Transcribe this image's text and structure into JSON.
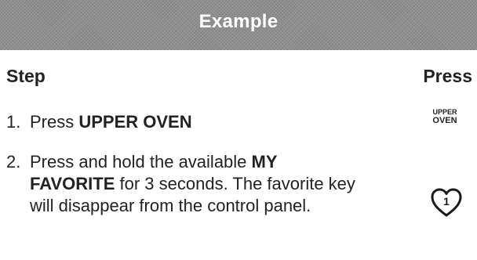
{
  "banner": {
    "title": "Example"
  },
  "columns": {
    "step": "Step",
    "press": "Press"
  },
  "steps": [
    {
      "number": "1.",
      "text_pre": "Press ",
      "text_bold": "UPPER OVEN",
      "text_post": ""
    },
    {
      "number": "2.",
      "text_pre": "Press and hold the available ",
      "text_bold": "MY FAVORITE",
      "text_post": " for 3 seconds. The favorite key will disappear from the control panel."
    }
  ],
  "keys": {
    "upper_oven_line1": "UPPER",
    "upper_oven_line2": "OVEN",
    "favorite_number": "1",
    "favorite_icon": "heart-icon"
  }
}
